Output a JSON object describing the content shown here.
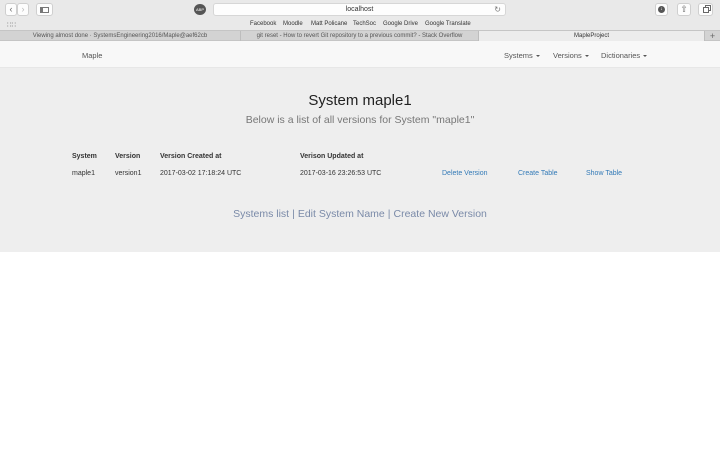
{
  "browser": {
    "url": "localhost",
    "ext_badge": "ABP",
    "bookmarks": [
      "Facebook",
      "Moodle",
      "Matt Policane",
      "TechSoc",
      "Google Drive",
      "Google Translate"
    ],
    "tabs": [
      {
        "label": "Viewing almost done · SystemsEngineering2016/Maple@aef62cb"
      },
      {
        "label": "git reset - How to revert Git repository to a previous commit? - Stack Overflow"
      },
      {
        "label": "MapleProject"
      }
    ]
  },
  "navbar": {
    "brand": "Maple",
    "items": [
      {
        "label": "Systems"
      },
      {
        "label": "Versions"
      },
      {
        "label": "Dictionaries"
      }
    ]
  },
  "main": {
    "title": "System maple1",
    "subtitle": "Below is a list of all versions for System \"maple1\"",
    "table": {
      "headers": [
        "System",
        "Version",
        "Version Created at",
        "Verison Updated at"
      ],
      "rows": [
        {
          "system": "maple1",
          "version": "version1",
          "created": "2017-03-02 17:18:24 UTC",
          "updated": "2017-03-16 23:26:53 UTC",
          "actions": [
            "Delete Version",
            "Create Table",
            "Show Table"
          ]
        }
      ]
    },
    "links": [
      "Systems list",
      "Edit System Name",
      "Create New Version"
    ],
    "separator": "|"
  }
}
